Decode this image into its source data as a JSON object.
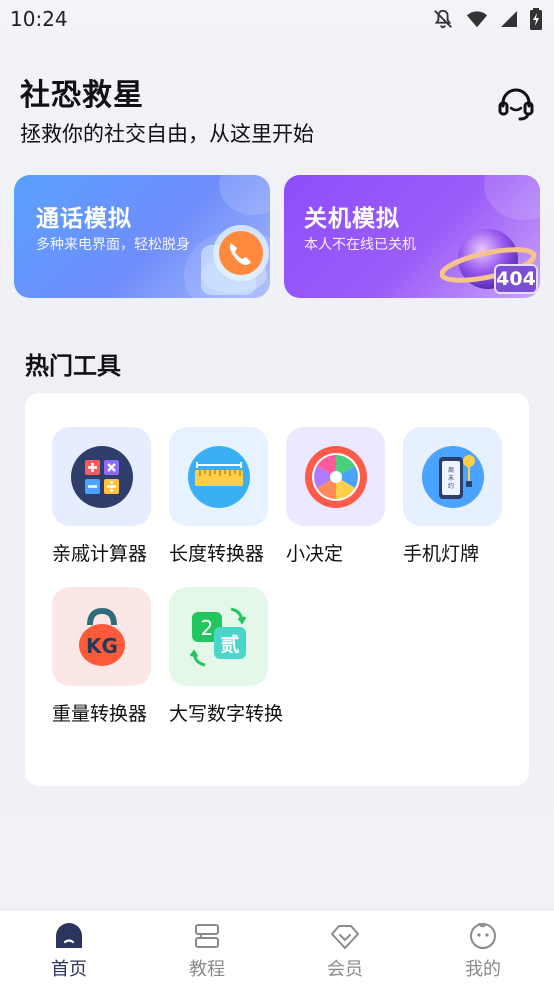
{
  "status_bar": {
    "time": "10:24"
  },
  "header": {
    "title": "社恐救星",
    "subtitle": "拯救你的社交自由，从这里开始"
  },
  "cards": {
    "call": {
      "title": "通话模拟",
      "desc": "多种来电界面，轻松脱身"
    },
    "shutdown": {
      "title": "关机模拟",
      "desc": "本人不在线已关机",
      "badge": "404"
    }
  },
  "section": {
    "title": "热门工具"
  },
  "tools": [
    {
      "label": "亲戚计算器",
      "icon": "calculator-icon",
      "tile_color": "#e6edff"
    },
    {
      "label": "长度转换器",
      "icon": "ruler-icon",
      "tile_color": "#e6f2ff"
    },
    {
      "label": "小决定",
      "icon": "spinner-wheel-icon",
      "tile_color": "#ece8ff"
    },
    {
      "label": "手机灯牌",
      "icon": "phone-lightboard-icon",
      "tile_color": "#e6f0ff"
    },
    {
      "label": "重量转换器",
      "icon": "kettlebell-kg-icon",
      "tile_color": "#fbe8e6"
    },
    {
      "label": "大写数字转换",
      "icon": "number-convert-icon",
      "tile_color": "#e3f8e8"
    }
  ],
  "tools_icon_text": {
    "kg": "KG",
    "two": "2",
    "er": "贰",
    "phone_text": "周末约"
  },
  "tabbar": [
    {
      "label": "首页",
      "icon": "home-icon",
      "active": true
    },
    {
      "label": "教程",
      "icon": "tutorial-icon",
      "active": false
    },
    {
      "label": "会员",
      "icon": "vip-diamond-icon",
      "active": false
    },
    {
      "label": "我的",
      "icon": "profile-face-icon",
      "active": false
    }
  ]
}
